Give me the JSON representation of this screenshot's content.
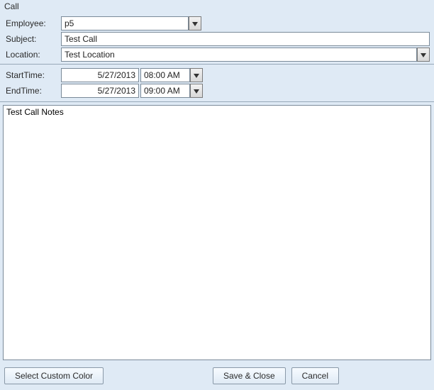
{
  "window": {
    "title": "Call"
  },
  "fields": {
    "employee": {
      "label": "Employee:",
      "value": "p5"
    },
    "subject": {
      "label": "Subject:",
      "value": "Test Call"
    },
    "location": {
      "label": "Location:",
      "value": "Test Location"
    },
    "start": {
      "label": "StartTime:",
      "date": "5/27/2013",
      "time": "08:00 AM"
    },
    "end": {
      "label": "EndTime:",
      "date": "5/27/2013",
      "time": "09:00 AM"
    },
    "notes": {
      "value": "Test Call Notes"
    }
  },
  "buttons": {
    "color": "Select Custom Color",
    "save": "Save & Close",
    "cancel": "Cancel"
  }
}
